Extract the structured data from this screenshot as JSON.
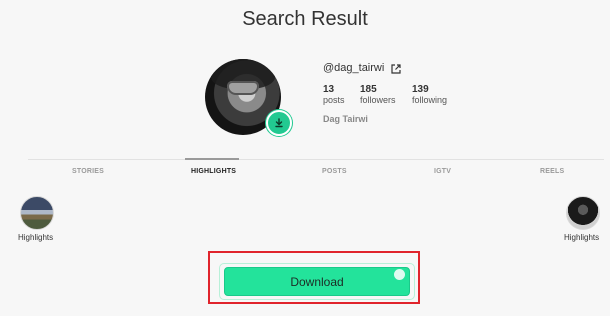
{
  "page": {
    "title": "Search Result"
  },
  "profile": {
    "username": "@dag_tairwi",
    "full_name": "Dag Tairwi",
    "stats": [
      {
        "value": "13",
        "label": "posts"
      },
      {
        "value": "185",
        "label": "followers"
      },
      {
        "value": "139",
        "label": "following"
      }
    ]
  },
  "tabs": [
    "STORIES",
    "HIGHLIGHTS",
    "POSTS",
    "IGTV",
    "REELS"
  ],
  "active_tab": "HIGHLIGHTS",
  "highlights": [
    {
      "label": "Highlights"
    },
    {
      "label": "Highlights"
    }
  ],
  "download": {
    "label": "Download"
  },
  "colors": {
    "accent": "#23e39b",
    "frame": "#e0242c"
  }
}
